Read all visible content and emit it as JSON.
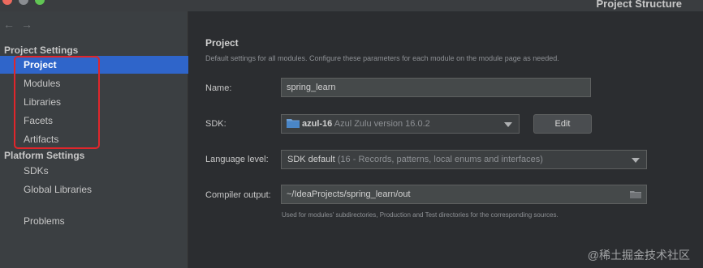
{
  "window": {
    "title": "Project Structure"
  },
  "sidebar": {
    "project_settings_header": "Project Settings",
    "project_items": [
      {
        "label": "Project",
        "selected": true
      },
      {
        "label": "Modules"
      },
      {
        "label": "Libraries"
      },
      {
        "label": "Facets"
      },
      {
        "label": "Artifacts"
      }
    ],
    "platform_settings_header": "Platform Settings",
    "platform_items": [
      {
        "label": "SDKs"
      },
      {
        "label": "Global Libraries"
      }
    ],
    "other_items": [
      {
        "label": "Problems"
      }
    ],
    "nav_back_glyph": "←",
    "nav_forward_glyph": "→"
  },
  "main": {
    "title": "Project",
    "description": "Default settings for all modules. Configure these parameters for each module on the module page as needed.",
    "name": {
      "label": "Name:",
      "value": "spring_learn"
    },
    "sdk": {
      "label": "SDK:",
      "value_name": "azul-16",
      "value_detail": "Azul Zulu version 16.0.2",
      "edit_label": "Edit"
    },
    "language_level": {
      "label": "Language level:",
      "value_name": "SDK default",
      "value_detail": "(16 - Records, patterns, local enums and interfaces)"
    },
    "compiler_output": {
      "label": "Compiler output:",
      "value": "~/IdeaProjects/spring_learn/out",
      "help": "Used for modules' subdirectories, Production and Test directories for the corresponding sources."
    }
  },
  "watermark": "@稀土掘金技术社区",
  "colors": {
    "accent": "#2f65ca",
    "highlight": "#e0262b"
  }
}
